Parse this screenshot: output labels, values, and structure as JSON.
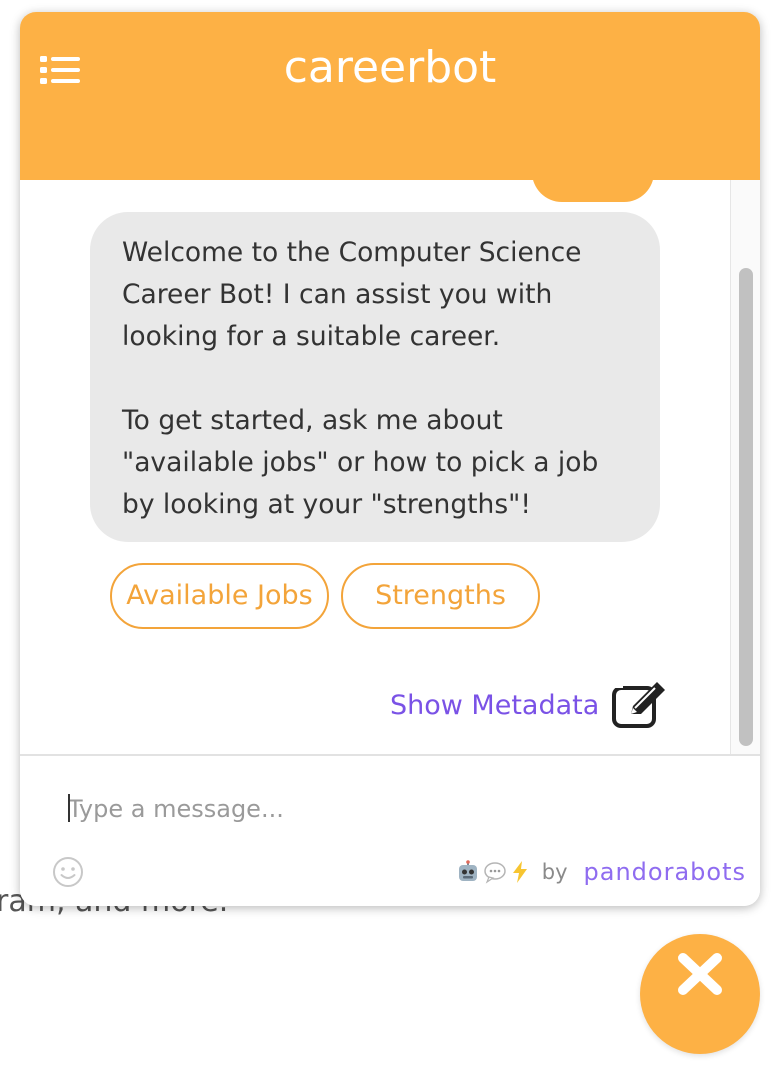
{
  "background": {
    "text": "ram, and more."
  },
  "header": {
    "title": "careerbot",
    "menu_icon": "list-icon"
  },
  "chat": {
    "bot_message": "Welcome to the Computer Science Career Bot! I can assist you with looking for a suitable career.\n\nTo get started, ask me about \"available jobs\" or how to pick a job by looking at your \"strengths\"!",
    "quick_replies": [
      "Available Jobs",
      "Strengths"
    ],
    "metadata_link": "Show Metadata",
    "metadata_icon": "edit-icon"
  },
  "composer": {
    "placeholder": "Type a message...",
    "emoji_icon": "smiley-icon",
    "powered_by": "by",
    "brand": "pandorabots"
  },
  "close_button_icon": "close-icon",
  "colors": {
    "header": "#fdb145",
    "chip": "#f3a43a",
    "link": "#7a52e6",
    "brand": "#8f6cf0",
    "bot_bubble": "#e9e9e9"
  }
}
